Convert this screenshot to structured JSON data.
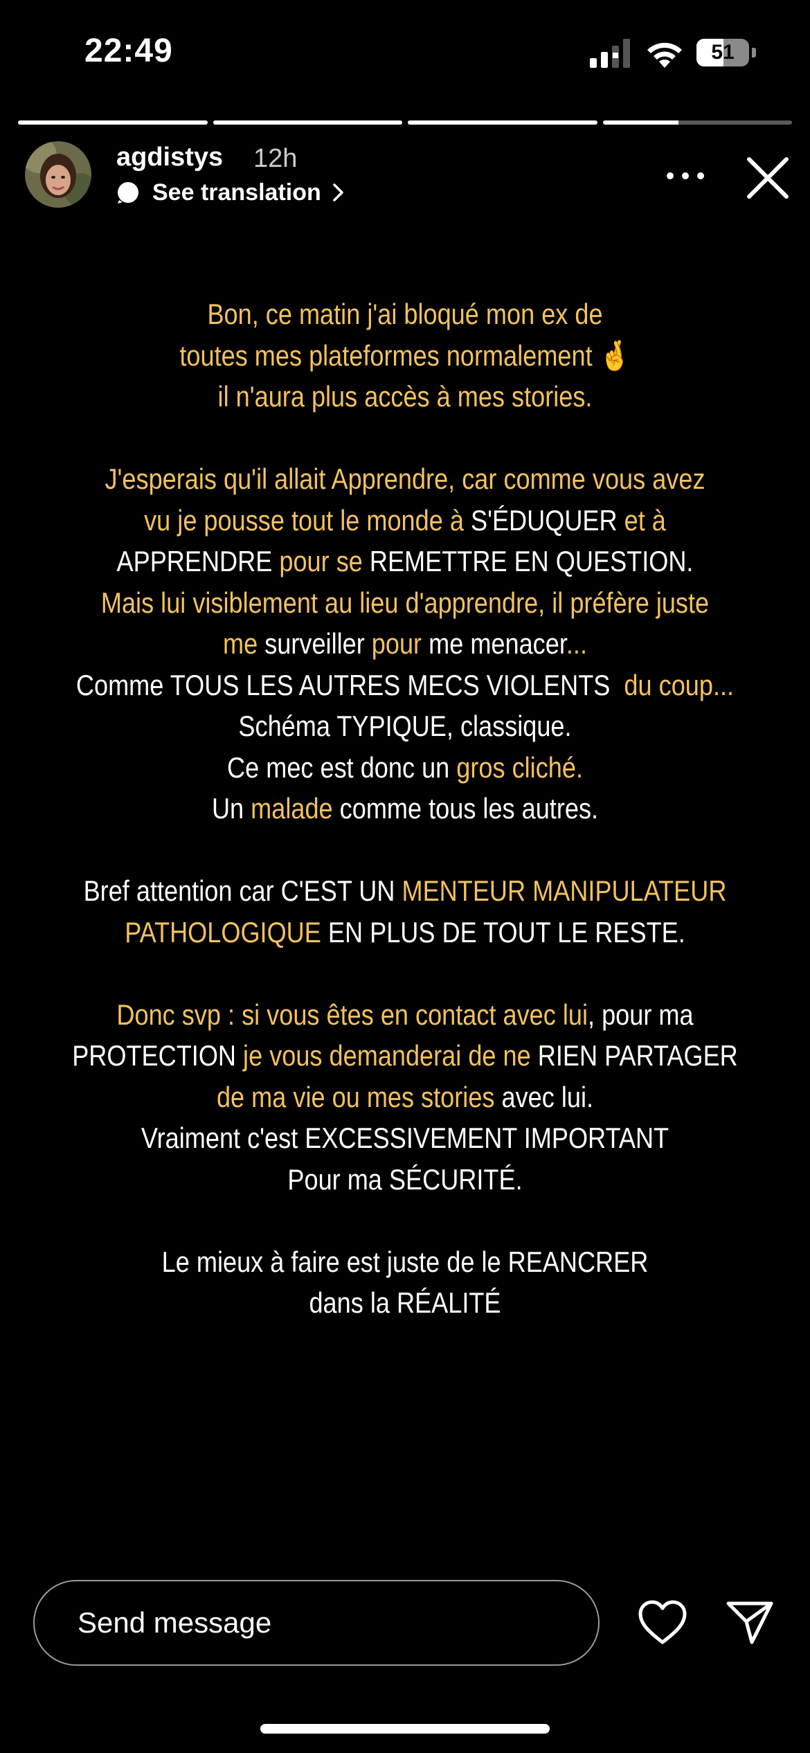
{
  "status_bar": {
    "time": "22:49",
    "battery_level": "51",
    "battery_fraction": 0.51,
    "icons": [
      "cellular-signal-icon",
      "wifi-icon",
      "battery-icon"
    ]
  },
  "story": {
    "segments_total": 4,
    "segments_completed": 3,
    "current_segment_progress": 0.4
  },
  "header": {
    "username": "agdistys",
    "time_ago": "12h",
    "translation_label": "See translation",
    "icons": [
      "avatar",
      "translate-icon",
      "chevron-right-icon",
      "more-icon",
      "close-icon"
    ]
  },
  "colors": {
    "highlight": "#f3c25e",
    "text": "#ffffff",
    "background": "#000000"
  },
  "story_text": {
    "p1": {
      "l1": "Bon, ce matin j'ai bloqué mon ex de",
      "l2": "toutes mes plateformes normalement",
      "l2_emoji": "🤞",
      "l3": "il n'aura plus accès à mes stories."
    },
    "p2": {
      "l1": "J'esperais qu'il allait Apprendre, car comme vous avez",
      "l2a": "vu je pousse tout le monde à ",
      "l2b": "S'ÉDUQUER",
      "l2c": " et à",
      "l3a": "APPRENDRE",
      "l3b": " pour se ",
      "l3c": "REMETTRE EN QUESTION.",
      "l4": "Mais lui visiblement au lieu d'apprendre, il préfère juste",
      "l5a": "me",
      "l5b": " surveiller ",
      "l5c": "pour",
      "l5d": " me menacer",
      "l5e": "...",
      "l6a": "Comme TOUS LES AUTRES MECS VIOLENTS ",
      "l6b": " du coup...",
      "l7": "Schéma TYPIQUE, classique.",
      "l8a": "Ce mec est donc un ",
      "l8b": "gros cliché.",
      "l9a": "Un ",
      "l9b": "malade",
      "l9c": " comme tous les autres."
    },
    "p3": {
      "l1a": "Bref attention car C'EST UN ",
      "l1b": "MENTEUR MANIPULATEUR",
      "l2a": "PATHOLOGIQUE",
      "l2b": " EN PLUS DE TOUT LE RESTE."
    },
    "p4": {
      "l1a": "Donc svp : si vous êtes en contact avec lui",
      "l1b": ", pour ma",
      "l2a": "PROTECTION",
      "l2b": " je vous demanderai de ne ",
      "l2c": "RIEN PARTAGER",
      "l3a": "de ma vie ou mes stories",
      "l3b": " avec lui.",
      "l4": "Vraiment c'est EXCESSIVEMENT IMPORTANT",
      "l5": "Pour ma SÉCURITÉ."
    },
    "p5": {
      "l1": "Le mieux à faire est juste de le REANCRER",
      "l2": "dans la RÉALITÉ"
    }
  },
  "footer": {
    "message_placeholder": "Send message",
    "icons": [
      "heart-icon",
      "share-icon"
    ]
  }
}
